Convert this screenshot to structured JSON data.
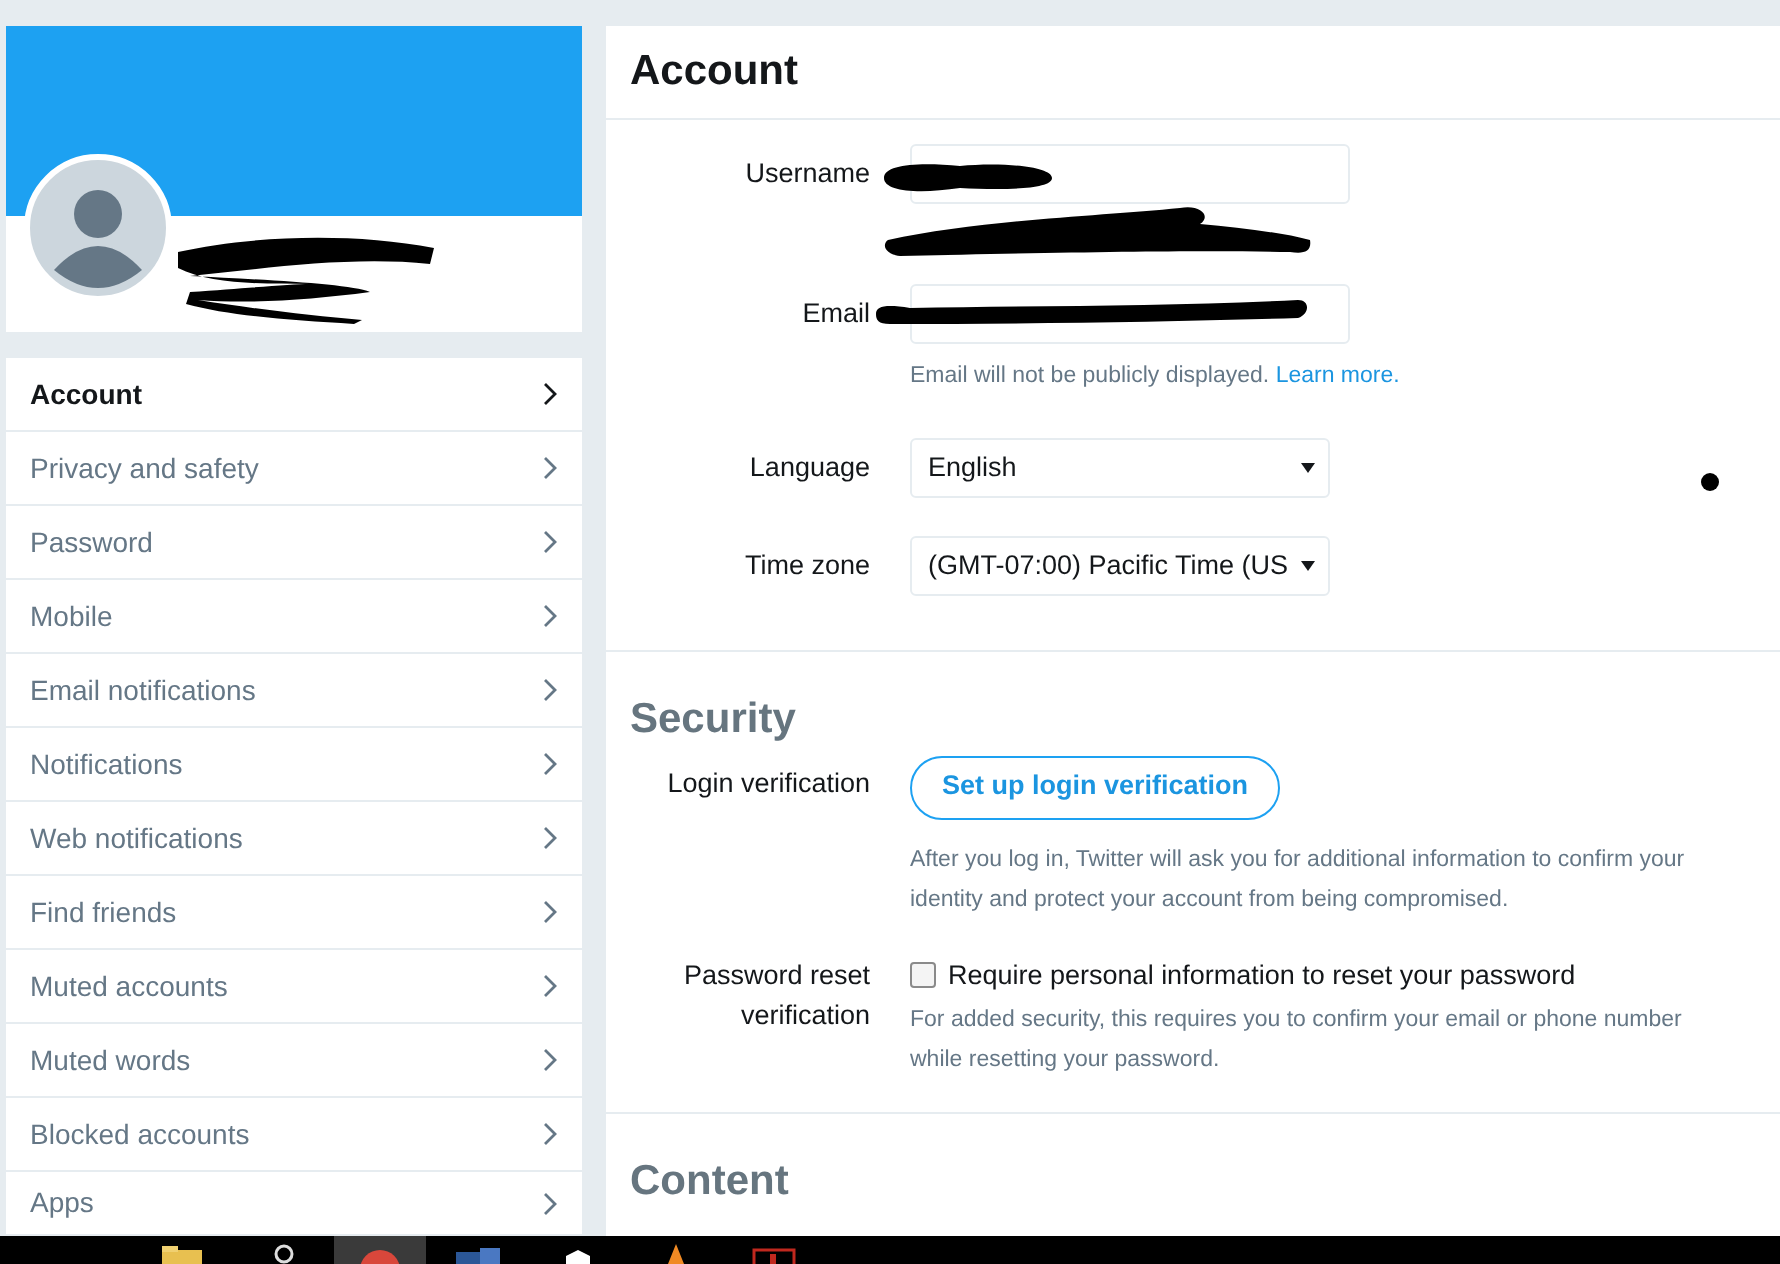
{
  "sidebar": {
    "items": [
      {
        "label": "Account",
        "selected": true
      },
      {
        "label": "Privacy and safety",
        "selected": false
      },
      {
        "label": "Password",
        "selected": false
      },
      {
        "label": "Mobile",
        "selected": false
      },
      {
        "label": "Email notifications",
        "selected": false
      },
      {
        "label": "Notifications",
        "selected": false
      },
      {
        "label": "Web notifications",
        "selected": false
      },
      {
        "label": "Find friends",
        "selected": false
      },
      {
        "label": "Muted accounts",
        "selected": false
      },
      {
        "label": "Muted words",
        "selected": false
      },
      {
        "label": "Blocked accounts",
        "selected": false
      },
      {
        "label": "Apps",
        "selected": false
      }
    ]
  },
  "main": {
    "sections": [
      {
        "title": "Account",
        "rows": [
          {
            "kind": "input",
            "label": "Username"
          },
          {
            "kind": "input",
            "label": "Email",
            "help": "Email will not be publicly displayed.",
            "link": "Learn more."
          },
          {
            "kind": "select",
            "label": "Language",
            "value": "English"
          },
          {
            "kind": "select",
            "label": "Time zone",
            "value": "(GMT-07:00) Pacific Time (US"
          }
        ]
      },
      {
        "title": "Security",
        "rows": [
          {
            "kind": "button",
            "label": "Login verification",
            "button": "Set up login verification",
            "help": "After you log in, Twitter will ask you for additional information to confirm your identity and protect your account from being compromised."
          },
          {
            "kind": "checkbox",
            "label": "Password reset verification",
            "checked": false,
            "option": "Require personal information to reset your password",
            "help": "For added security, this requires you to confirm your email or phone number while resetting your password."
          }
        ]
      },
      {
        "title": "Content"
      }
    ]
  }
}
